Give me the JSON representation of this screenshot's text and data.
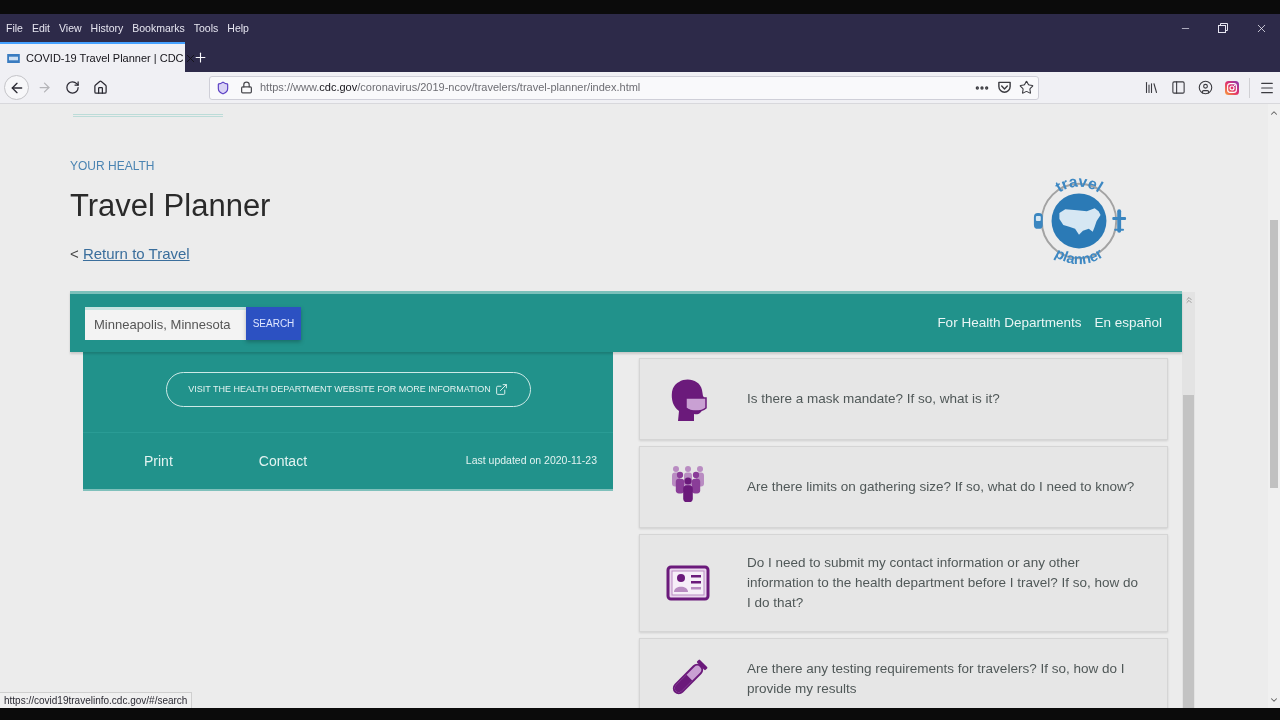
{
  "browser": {
    "menu": [
      "File",
      "Edit",
      "View",
      "History",
      "Bookmarks",
      "Tools",
      "Help"
    ],
    "tabs": [
      {
        "title": "COVID-19 Travel Planner | CDC",
        "selected": true
      }
    ],
    "nav_buttons": [
      {
        "kind": "back",
        "disabled": false
      },
      {
        "kind": "forward",
        "disabled": true
      },
      {
        "kind": "reload",
        "disabled": false
      },
      {
        "kind": "home",
        "disabled": false
      }
    ],
    "url": {
      "prefix": "https://www.",
      "host": "cdc.gov",
      "path": "/coronavirus/2019-ncov/travelers/travel-planner/index.html"
    },
    "status_link": "https://covid19travelinfo.cdc.gov/#/search"
  },
  "page": {
    "eyebrow": "YOUR HEALTH",
    "title": "Travel Planner",
    "back_link": {
      "prefix": "<",
      "label": "Return to Travel"
    },
    "logo": {
      "top_text": "travel",
      "bottom_text": "planner"
    },
    "search": {
      "value": "Minneapolis, Minnesota",
      "button": "SEARCH"
    },
    "header_links": [
      "For Health Departments",
      "En español"
    ],
    "health_card": {
      "visit_button": "VISIT THE HEALTH DEPARTMENT WEBSITE FOR MORE INFORMATION",
      "footer_links": [
        "Print",
        "Contact"
      ],
      "updated": "Last updated on 2020-11-23"
    },
    "questions": [
      {
        "kind": "mask",
        "text": "Is there a mask mandate? If so, what is it?"
      },
      {
        "kind": "crowd",
        "text": "Are there limits on gathering size? If so, what do I need to know?"
      },
      {
        "kind": "id-card",
        "text": "Do I need to submit my contact information or any other information to the health department before I travel? If so, how do I do that?"
      },
      {
        "kind": "test-tube",
        "text": "Are there any testing requirements for travelers? If so, how do I provide my results"
      }
    ]
  }
}
